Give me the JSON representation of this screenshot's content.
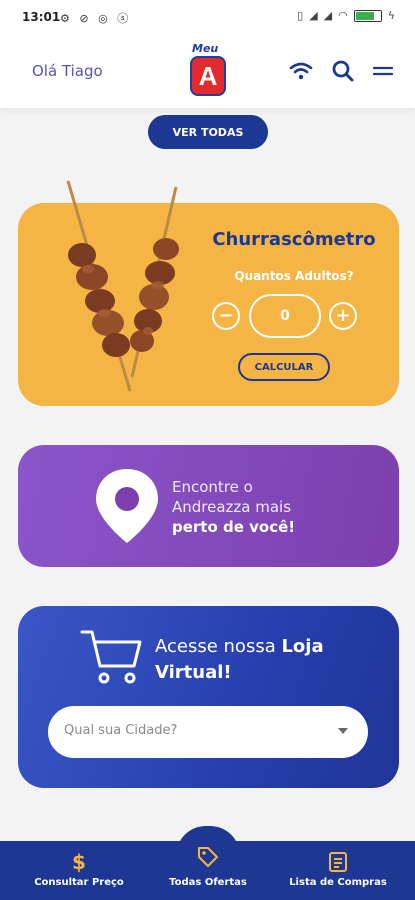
{
  "status_bar": {
    "time": "13:01",
    "icons_left": [
      "sync-icon",
      "no-disturb-icon",
      "shazam-icon",
      "dollar-circle-icon"
    ],
    "icons_right": [
      "vibrate-icon",
      "signal-icon",
      "signal-icon",
      "wifi-icon",
      "battery-icon",
      "charging-icon"
    ]
  },
  "header": {
    "greeting": "Olá Tiago",
    "logo_top": "Meu",
    "logo_letter": "A",
    "icons": [
      "wifi-icon",
      "search-icon",
      "menu-icon"
    ]
  },
  "offers": {
    "see_all_label": "VER TODAS"
  },
  "churrasco": {
    "title": "Churrascômetro",
    "question": "Quantos Adultos?",
    "minus_label": "−",
    "quantity": "0",
    "plus_label": "+",
    "calculate_label": "CALCULAR"
  },
  "locator": {
    "line1": "Encontre o",
    "line2": "Andreazza mais",
    "line3_bold": "perto de você!"
  },
  "virtual_store": {
    "text_prefix": "Acesse nossa ",
    "text_bold_1": "Loja",
    "text_bold_2": "Virtual!",
    "city_placeholder": "Qual sua Cidade?"
  },
  "bottom_nav": {
    "items": [
      {
        "label": "Consultar Preço",
        "icon": "dollar-icon"
      },
      {
        "label": "Todas Ofertas",
        "icon": "tag-icon"
      },
      {
        "label": "Lista de Compras",
        "icon": "list-icon"
      }
    ]
  },
  "colors": {
    "primary_blue": "#1d3792",
    "churrasco_yellow": "#f4b545",
    "locator_purple": "#8a56c9",
    "greeting_purple": "#5b53b4",
    "logo_red": "#e32b2b"
  }
}
